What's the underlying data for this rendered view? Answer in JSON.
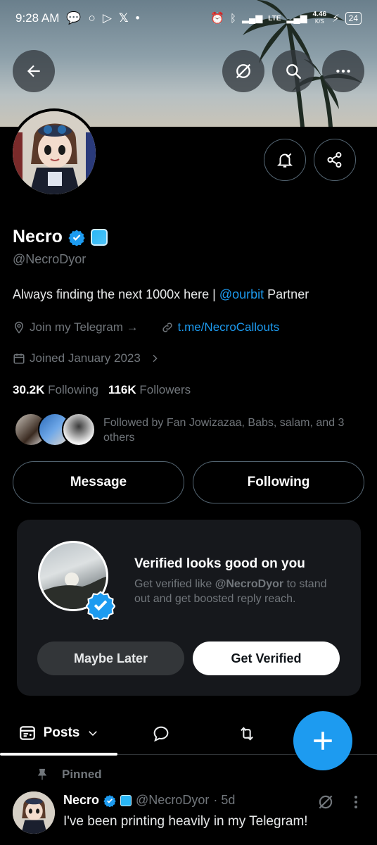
{
  "status_bar": {
    "time": "9:28 AM",
    "network": "LTE",
    "speed": "4.46",
    "speed_unit": "K/S",
    "battery": "24"
  },
  "profile": {
    "name": "Necro",
    "handle": "@NecroDyor",
    "bio_prefix": "Always finding the next 1000x here | ",
    "bio_mention": "@ourbit",
    "bio_suffix": " Partner",
    "location": "Join my Telegram →",
    "website": "t.me/NecroCallouts",
    "joined": "Joined January 2023",
    "following_count": "30.2K",
    "following_label": "Following",
    "followers_count": "116K",
    "followers_label": "Followers",
    "followed_by": "Followed by Fan Jowizazaa, Babs, salam, and 3 others"
  },
  "actions": {
    "message": "Message",
    "following": "Following"
  },
  "verify_card": {
    "title": "Verified looks good on you",
    "sub_prefix": "Get verified like ",
    "sub_handle": "@NecroDyor",
    "sub_suffix": " to stand out and get boosted reply reach.",
    "maybe_later": "Maybe Later",
    "get_verified": "Get Verified"
  },
  "tabs": {
    "posts": "Posts"
  },
  "pinned_post": {
    "pinned_label": "Pinned",
    "name": "Necro",
    "handle": "@NecroDyor",
    "time": "· 5d",
    "text": "I've been printing heavily in my Telegram!"
  },
  "colors": {
    "accent": "#1d9bf0",
    "background": "#000000",
    "muted": "#71767b"
  }
}
